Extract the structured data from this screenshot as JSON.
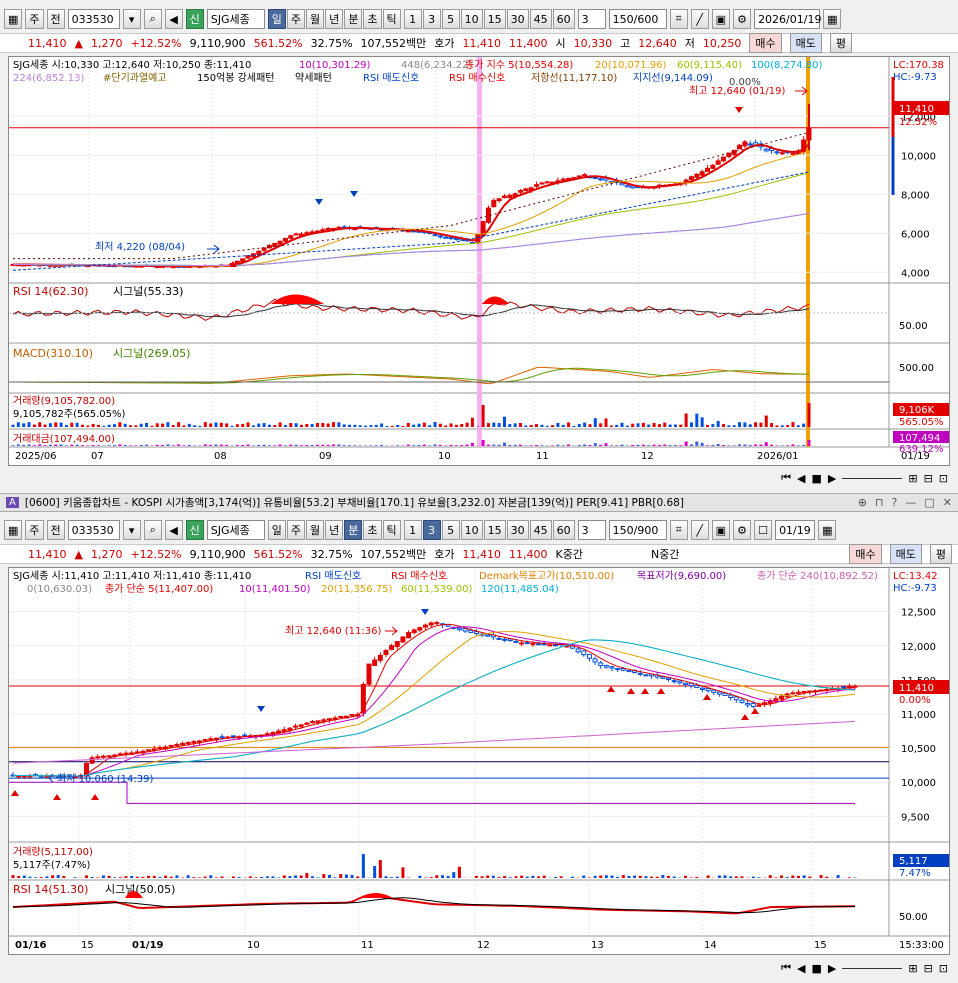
{
  "top": {
    "toolbar": {
      "type_label": "주",
      "prev_label": "전",
      "code": "033530",
      "stock_tag": "신",
      "stock_name": "SJG세종",
      "periods": [
        "일",
        "주",
        "월",
        "년",
        "분",
        "초",
        "틱"
      ],
      "active_period": "일",
      "nums": [
        "1",
        "3",
        "5",
        "10",
        "15",
        "30",
        "45",
        "60"
      ],
      "n_value": "3",
      "count": "150",
      "count_max": "/600",
      "date": "2026/01/19"
    },
    "quote": {
      "price": "11,410",
      "change": "1,270",
      "change_pct": "+12.52%",
      "volume": "9,110,900",
      "vol_ratio": "561.52%",
      "turnover": "32.75%",
      "amount": "107,552백만",
      "quote_label": "호가",
      "ask": "11,410",
      "bid": "11,400",
      "open_label": "시",
      "open": "10,330",
      "high_label": "고",
      "high": "12,640",
      "low_label": "저",
      "low": "10,250",
      "buy": "매수",
      "sell": "매도",
      "eval": "평"
    },
    "chart": {
      "legend1": [
        "SJG세종 시:10,330 고:12,640 저:10,250 종:11,410",
        "10(10,301.29)",
        "448(6,234.22)",
        "종가 지수 5(10,554.28)",
        "20(10,071.96)",
        "60(9,115.40)",
        "100(8,274.80)"
      ],
      "legend2": [
        "224(6,852.13)",
        "#단기과열예고",
        "150억봉 강세패턴",
        "약세패턴",
        "RSI 매도신호",
        "RSI 매수신호",
        "저항선(11,177.10)",
        "지지선(9,144.09)"
      ],
      "lc": "LC:170.38",
      "hc": "HC:-9.73",
      "price_tag": "11,410",
      "pct_tag": "12.52%",
      "y_ticks": [
        "12,000",
        "10,000",
        "8,000",
        "6,000",
        "4,000"
      ],
      "high_note": "최고 12,640 (01/19)",
      "low_note": "최저 4,220 (08/04)",
      "pct_note": "0.00%",
      "rsi_title": "RSI 14(62.30)",
      "rsi_signal": "시그널(55.33)",
      "rsi_tick": "50.00",
      "macd_title": "MACD(310.10)",
      "macd_signal": "시그널(269.05)",
      "macd_tick": "500.00",
      "vol_title": "거래량(9,105,782.00)",
      "vol_sub": "9,105,782주(565.05%)",
      "vol_tag": "9,106K",
      "vol_tag2": "565.05%",
      "amt_title": "거래대금(107,494.00)",
      "amt_tag": "107,494",
      "amt_tag2": "639.12%",
      "x_labels": [
        "2025/06",
        "07",
        "08",
        "09",
        "10",
        "11",
        "12",
        "2026/01"
      ],
      "x_right": "01/19"
    }
  },
  "bottom": {
    "title": "[0600] 키움종합차트 - KOSPI 시가총액[3,174(억)] 유통비율[53.2] 부채비율[170.1] 유보율[3,232.0] 자본금[139(억)] PER[9.41] PBR[0.68]",
    "toolbar": {
      "type_label": "주",
      "prev_label": "전",
      "code": "033530",
      "stock_tag": "신",
      "stock_name": "SJG세종",
      "periods": [
        "일",
        "주",
        "월",
        "년",
        "분",
        "초",
        "틱"
      ],
      "active_period": "분",
      "nums": [
        "1",
        "3",
        "5",
        "10",
        "15",
        "30",
        "45",
        "60"
      ],
      "n_value": "3",
      "count": "150",
      "count_max": "/900",
      "date": "01/19"
    },
    "quote": {
      "price": "11,410",
      "change": "1,270",
      "change_pct": "+12.52%",
      "volume": "9,110,900",
      "vol_ratio": "561.52%",
      "turnover": "32.75%",
      "amount": "107,552백만",
      "quote_label": "호가",
      "ask": "11,410",
      "bid": "11,400",
      "k_label": "K중간",
      "n_label": "N중간",
      "buy": "매수",
      "sell": "매도",
      "eval": "평"
    },
    "chart": {
      "legend1": [
        "SJG세종 시:11,410 고:11,410 저:11,410 종:11,410",
        "RSI 매도신호",
        "RSI 매수신호",
        "Demark목표고가(10,510.00)",
        "목표저가(9,690.00)",
        "종가 단순 240(10,892.52)"
      ],
      "legend2": [
        "0(10,630.03)",
        "종가 단순 5(11,407.00)",
        "10(11,401.50)",
        "20(11,356.75)",
        "60(11,539.00)",
        "120(11,485.04)"
      ],
      "lc": "LC:13.42",
      "hc": "HC:-9.73",
      "price_tag": "11,410",
      "pct_tag": "0.00%",
      "y_ticks": [
        "12,500",
        "12,000",
        "11,500",
        "11,000",
        "10,500",
        "10,000",
        "9,500"
      ],
      "high_note": "최고 12,640 (11:36)",
      "low_note": "최저 10,060 (14:39)",
      "vol_title": "거래량(5,117.00)",
      "vol_sub": "5,117주(7.47%)",
      "vol_tag": "5,117",
      "vol_tag2": "7.47%",
      "rsi_title": "RSI 14(51.30)",
      "rsi_signal": "시그널(50.05)",
      "rsi_tick": "50.00",
      "x_labels": [
        "01/16",
        "15",
        "01/19",
        "10",
        "11",
        "12",
        "13",
        "14",
        "15"
      ],
      "x_right": "15:33:00"
    }
  },
  "colors": {
    "up": "#e00000",
    "down": "#0050e0",
    "ma5": "#e00000",
    "ma20": "#e0a000",
    "ma60": "#a0c000",
    "ma100": "#00b0e0",
    "ma224": "#c080e0"
  },
  "chart_data": [
    {
      "type": "candlestick",
      "title": "SJG세종 일봉",
      "x": [
        "2025/06",
        "07",
        "08",
        "09",
        "10",
        "11",
        "12",
        "2026/01",
        "01/19"
      ],
      "close": [
        4400,
        4350,
        4300,
        6300,
        5700,
        8500,
        9300,
        10140,
        11410
      ],
      "high_point": 12640,
      "low_point": 4220,
      "ylim": [
        3500,
        13500
      ],
      "indicators": {
        "rsi": 62.3,
        "rsi_signal": 55.33,
        "macd": 310.1,
        "macd_signal": 269.05,
        "volume": 9105782,
        "amount": 107494
      }
    },
    {
      "type": "candlestick",
      "title": "SJG세종 3분봉",
      "x": [
        "01/16",
        "15",
        "01/19",
        "10",
        "11",
        "12",
        "13",
        "14",
        "15"
      ],
      "close": [
        10110,
        10100,
        10300,
        10650,
        11700,
        12100,
        11700,
        11300,
        11410
      ],
      "high_point": 12640,
      "low_point": 10060,
      "ylim": [
        9300,
        12700
      ],
      "indicators": {
        "rsi": 51.3,
        "rsi_signal": 50.05,
        "volume": 5117
      }
    }
  ]
}
